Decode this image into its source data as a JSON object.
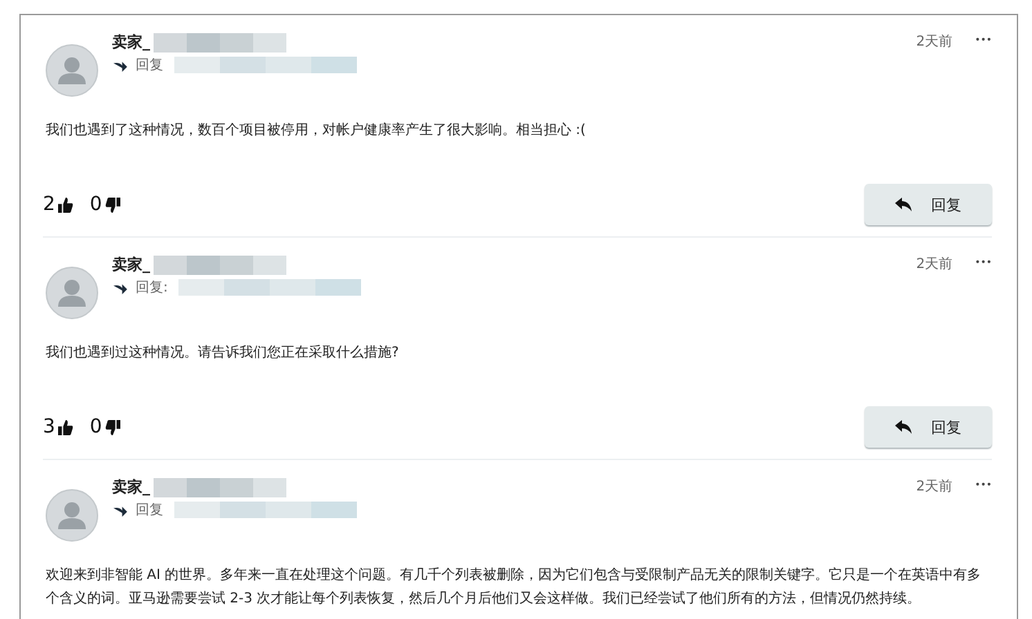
{
  "comments": [
    {
      "author": "卖家_",
      "reply_label": "回复",
      "time": "2天前",
      "more": "•••",
      "body": "我们也遇到了这种情况，数百个项目被停用，对帐户健康率产生了很大影响。相当担心 :(",
      "likes": "2",
      "dislikes": "0",
      "reply_button": "回复"
    },
    {
      "author": "卖家_",
      "reply_label": "回复:",
      "time": "2天前",
      "more": "•••",
      "body": "我们也遇到过这种情况。请告诉我们您正在采取什么措施?",
      "likes": "3",
      "dislikes": "0",
      "reply_button": "回复"
    },
    {
      "author": "卖家_",
      "reply_label": "回复",
      "time": "2天前",
      "more": "•••",
      "body": "欢迎来到非智能 AI 的世界。多年来一直在处理这个问题。有几千个列表被删除，因为它们包含与受限制产品无关的限制关键字。它只是一个在英语中有多个含义的词。亚马逊需要尝试 2-3 次才能让每个列表恢复，然后几个月后他们又会这样做。我们已经尝试了他们所有的方法，但情况仍然持续。"
    }
  ]
}
